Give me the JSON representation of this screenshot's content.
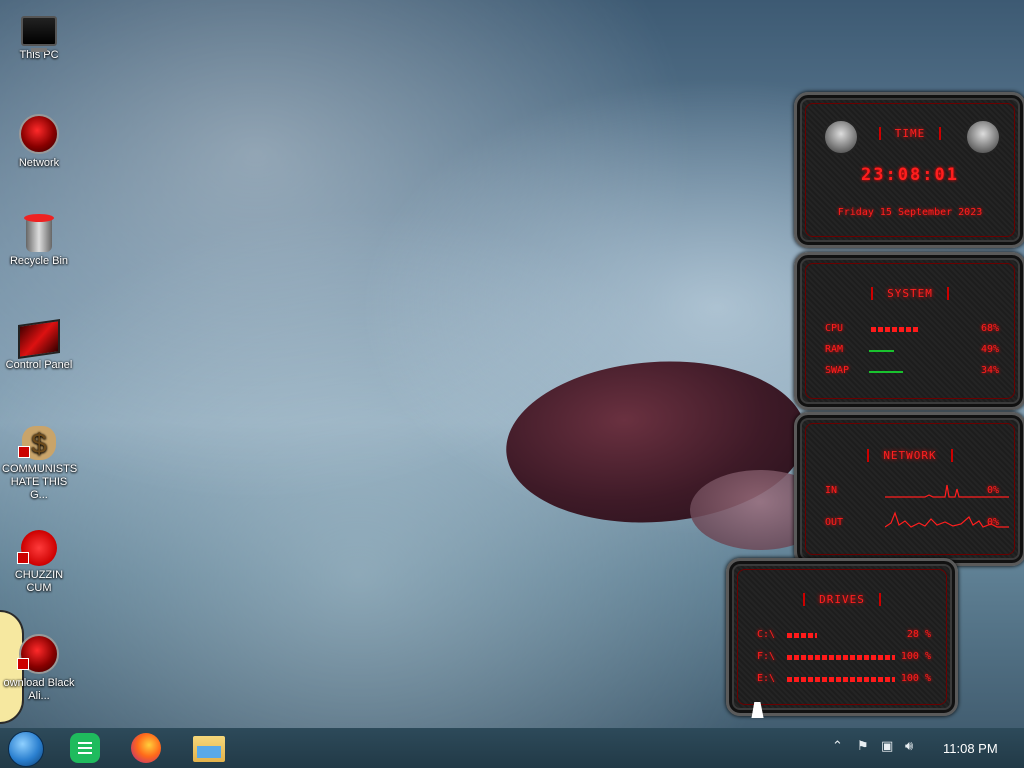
{
  "desktop": {
    "icons": [
      {
        "label": "This PC"
      },
      {
        "label": "Network"
      },
      {
        "label": "Recycle Bin"
      },
      {
        "label": "Control Panel"
      },
      {
        "label": "COMMUNISTS HATE THIS G..."
      },
      {
        "label": "CHUZZIN CUM"
      },
      {
        "label": "ownload Black Ali..."
      }
    ]
  },
  "widgets": {
    "time": {
      "title": "TIME",
      "clock": "23:08:01",
      "date": "Friday 15 September 2023"
    },
    "system": {
      "title": "SYSTEM",
      "rows": [
        {
          "label": "CPU",
          "value": "68%",
          "fill": 0.68
        },
        {
          "label": "RAM",
          "value": "49%",
          "fill": 0.49
        },
        {
          "label": "SWAP",
          "value": "34%",
          "fill": 0.34
        }
      ]
    },
    "network": {
      "title": "NETWORK",
      "rows": [
        {
          "label": "IN",
          "value": "0%"
        },
        {
          "label": "OUT",
          "value": "0%"
        }
      ]
    },
    "drives": {
      "title": "DRIVES",
      "rows": [
        {
          "label": "C:\\",
          "value": "28 %",
          "fill": 0.28
        },
        {
          "label": "F:\\",
          "value": "100 %",
          "fill": 1.0
        },
        {
          "label": "E:\\",
          "value": "100 %",
          "fill": 1.0
        }
      ]
    }
  },
  "taskbar": {
    "apps": [
      "start-orb",
      "sheets",
      "firefox",
      "file-explorer"
    ],
    "time": "11:08 PM"
  },
  "colors": {
    "accent_red": "#ff1e1e",
    "taskbar": "#223a47"
  }
}
